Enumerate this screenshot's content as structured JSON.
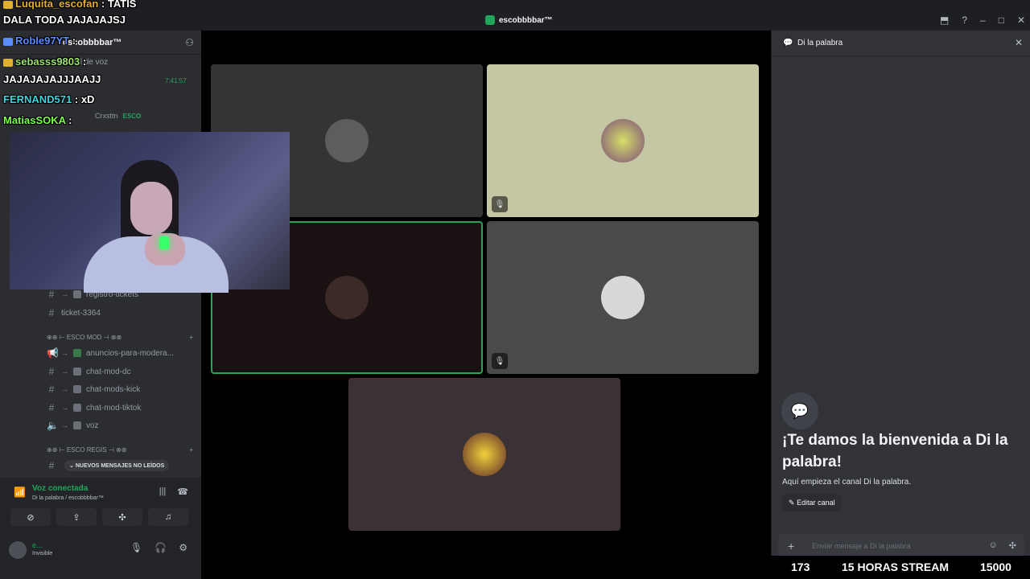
{
  "window": {
    "title": "escobbbbar™",
    "controls": [
      "⬒",
      "?",
      "–",
      "□",
      "✕"
    ]
  },
  "sidebar": {
    "server_name": "escobbbbar™",
    "hidden_text": "...ar canal de voz",
    "voice_time": "7:41:57",
    "member_line": "Crxsttn",
    "member_badge": "ESCO",
    "channels": [
      {
        "name": "registro-tickets",
        "type": "text"
      },
      {
        "name": "ticket-3364",
        "type": "text"
      }
    ],
    "category_mod": "⊕⊕ ⊢ ESCO MOD ⊣ ⊗⊗",
    "mod_channels": [
      {
        "name": "anuncios-para-modera...",
        "type": "announce"
      },
      {
        "name": "chat-mod-dc",
        "type": "text"
      },
      {
        "name": "chat-mods-kick",
        "type": "text"
      },
      {
        "name": "chat-mod-tiktok",
        "type": "text"
      },
      {
        "name": "voz",
        "type": "voice"
      }
    ],
    "category_regis": "⊕⊕ ⊢ ESCO REGIS ⊣ ⊗⊗",
    "new_messages": "NUEVOS MENSAJES NO LEÍDOS"
  },
  "voice": {
    "title": "Voz conectada",
    "channel": "Di la palabra / escobbbbar™"
  },
  "user": {
    "name": "e...",
    "status": "Invisible"
  },
  "right_panel": {
    "header": "Di la palabra",
    "welcome_title": "¡Te damos la bienvenida a Di la palabra!",
    "welcome_sub": "Aquí empieza el canal Di la palabra.",
    "edit_label": "Editar canal",
    "message_placeholder": "Enviar mensaje a Di la palabra"
  },
  "chat_overlay": [
    {
      "user": "Luquita_escofan",
      "msg": "TATIS",
      "color": "#e0b030"
    },
    {
      "user": "",
      "msg": "DALA TODA JAJAJAJSJ",
      "color": "#ffffff"
    },
    {
      "user": "Roble97YT",
      "msg": "",
      "color": "#5b8cff"
    },
    {
      "user": "sebasss9803",
      "msg": "",
      "color": "#9be36a"
    },
    {
      "user": "",
      "msg": "JAJAJAJAJJJAAJJ",
      "color": "#ffffff"
    },
    {
      "user": "FERNAND571",
      "msg": "xD",
      "color": "#3dd6e0"
    },
    {
      "user": "MatiasSOKA",
      "msg": "",
      "color": "#7cff4a"
    }
  ],
  "stats": {
    "viewers": "173",
    "label": "15 HORAS STREAM",
    "goal": "15000"
  },
  "colors": {
    "accent_green": "#23a55a",
    "bg_dark": "#2b2d31",
    "panel": "#313338"
  }
}
